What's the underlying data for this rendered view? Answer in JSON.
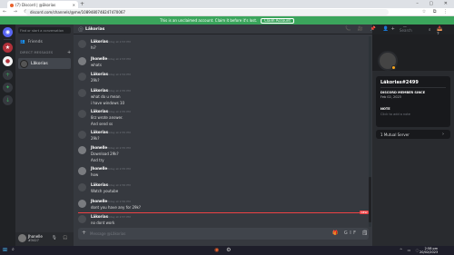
{
  "browser": {
    "tab_title": "(7) Discord | @ākorias",
    "url": "discord.com/channels/@me/1089480748247470067",
    "window_controls": "–  ▢  ✕",
    "new_tab": "+",
    "nav": "←  →  ⟳",
    "toolbar_icons": "☆  ⧉  ⋮"
  },
  "banner": {
    "text": "This is an unclaimed account. Claim it before it's lost.",
    "claim_label": "Claim Account"
  },
  "rail": {
    "icons": [
      "discord-home-icon",
      "add-server-icon",
      "explore-icon",
      "download-icon"
    ]
  },
  "sidebar": {
    "find_placeholder": "Find or start a conversation",
    "friends_label": "Friends",
    "friends_icon": "👥",
    "dm_header": "DIRECT MESSAGES",
    "dm_add": "+",
    "dm_items": [
      {
        "name": "Lãkorias"
      }
    ]
  },
  "user_panel": {
    "name": "Jhonelle",
    "tag": "#3427",
    "icons": "🎙 🎧 ⚙"
  },
  "chat": {
    "header_name": "Lãkorias",
    "header_icons": "📞 🎥 📌 👤+ 🗨",
    "messages": [
      {
        "author": "Lãkorias",
        "time": "Today at 2:53 PM",
        "color": "#ffffff",
        "lines": [
          "hi?"
        ]
      },
      {
        "author": "Jhonelle",
        "time": "Today at 2:53 PM",
        "color": "#ffffff",
        "lines": [
          "whats"
        ]
      },
      {
        "author": "Lãkorias",
        "time": "Today at 2:54 PM",
        "color": "#ffffff",
        "lines": [
          "29k?"
        ]
      },
      {
        "author": "Lãkorias",
        "time": "Today at 2:55 PM",
        "color": "#ffffff",
        "lines": [
          "what do u mean",
          "i have windows 10"
        ]
      },
      {
        "author": "Lãkorias",
        "time": "Today at 2:55 PM",
        "color": "#ffffff",
        "lines": [
          "8rz wrote answer.",
          "And send ss"
        ]
      },
      {
        "author": "Lãkorias",
        "time": "Today at 2:55 PM",
        "color": "#ffffff",
        "lines": [
          "29k?"
        ]
      },
      {
        "author": "Jhonelle",
        "time": "Today at 2:55 PM",
        "color": "#ffffff",
        "lines": [
          "Download 29k?",
          "And try"
        ]
      },
      {
        "author": "Jhonelle",
        "time": "Today at 2:55 PM",
        "color": "#ffffff",
        "lines": [
          "how"
        ]
      },
      {
        "author": "Lãkorias",
        "time": "Today at 2:56 PM",
        "color": "#ffffff",
        "lines": [
          "Watch youtube"
        ]
      },
      {
        "author": "Jhonelle",
        "time": "Today at 2:56 PM",
        "color": "#ffffff",
        "lines": [
          "dont you have any for 29k?"
        ]
      },
      {
        "author": "Lãkorias",
        "time": "Today at 2:57 PM",
        "color": "#ffffff",
        "lines": [
          "no dont work"
        ]
      }
    ],
    "new_label": "NEW",
    "composer_placeholder": "Message @Lãkorias",
    "composer_plus": "+",
    "composer_icons": "🎁 GIF 🗒 ☺"
  },
  "search": {
    "placeholder": "Search",
    "icon": "⌕",
    "top_icons": "📥 ?"
  },
  "profile": {
    "name": "Lãkorias#2499",
    "member_since_header": "DISCORD MEMBER SINCE",
    "member_since": "Feb 02, 2023",
    "note_header": "NOTE",
    "note_placeholder": "Click to add a note",
    "mutual": "1 Mutual Server",
    "mutual_chevron": "›"
  },
  "taskbar": {
    "start": "⊞",
    "search": "⌕",
    "apps": "▣ ◉",
    "tray": "^ ▭ ◌",
    "time": "2:58 pm",
    "date": "20/02/2023"
  }
}
